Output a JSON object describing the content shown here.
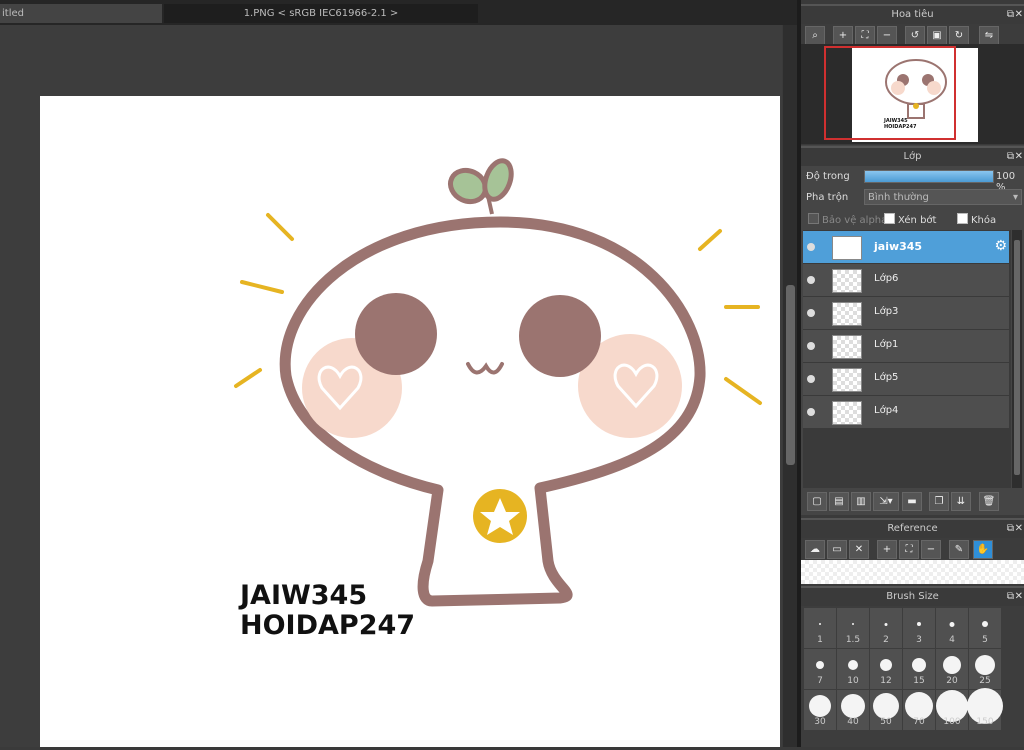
{
  "tabs": [
    "itled",
    "1.PNG < sRGB IEC61966-2.1 >"
  ],
  "artwork": {
    "line1": "JAIW345",
    "line2": "HOIDAP247"
  },
  "navigator": {
    "title": "Hoa tiêu",
    "thumb_line1": "JAIW345",
    "thumb_line2": "HOIDAP247"
  },
  "layer_panel": {
    "title": "Lớp",
    "opacity_label": "Độ trong",
    "opacity_value": "100 %",
    "opacity_fraction": 1.0,
    "blend_label": "Pha trộn",
    "blend_value": "Bình thường",
    "protect_alpha": "Bảo vệ alpha",
    "clipping": "Xén bớt",
    "lock": "Khóa",
    "layers": [
      {
        "name": "jaiw345",
        "selected": true
      },
      {
        "name": "Lớp6",
        "selected": false
      },
      {
        "name": "Lớp3",
        "selected": false
      },
      {
        "name": "Lớp1",
        "selected": false
      },
      {
        "name": "Lớp5",
        "selected": false
      },
      {
        "name": "Lớp4",
        "selected": false
      }
    ]
  },
  "reference": {
    "title": "Reference"
  },
  "brush_size": {
    "title": "Brush Size",
    "sizes": [
      "1",
      "1.5",
      "2",
      "3",
      "4",
      "5",
      "7",
      "10",
      "12",
      "15",
      "20",
      "25",
      "30",
      "40",
      "50",
      "70",
      "100",
      "150"
    ]
  },
  "colors": {
    "accent": "#4f9fd9",
    "outline": "#9b7470",
    "cheek": "#f7d9cc",
    "leaf": "#a6c397",
    "gold": "#e6b422"
  }
}
